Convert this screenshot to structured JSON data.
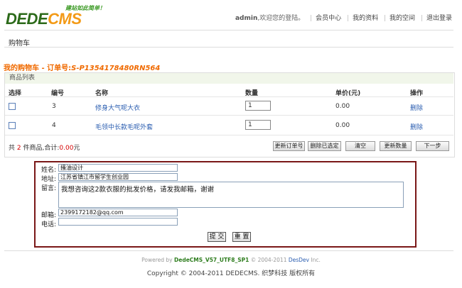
{
  "header": {
    "logo_main": "DEDE",
    "logo_accent": "CMS",
    "slogan": "建站如此简单！",
    "user": "admin",
    "welcome": ",欢迎您的登陆。",
    "nav": [
      "会员中心",
      "我的资料",
      "我的空间",
      "退出登录"
    ]
  },
  "breadcrumb": "购物车",
  "order": {
    "title_prefix": "我的购物车 - 订单号:",
    "order_no": "S-P1354178480RN564"
  },
  "list": {
    "caption": "商品列表",
    "columns": [
      "选择",
      "编号",
      "名称",
      "数量",
      "单价(元)",
      "操作"
    ],
    "rows": [
      {
        "id": "3",
        "name": "修身大气呢大衣",
        "qty": "1",
        "price": "0.00",
        "action": "删除"
      },
      {
        "id": "4",
        "name": "毛领中长款毛呢外套",
        "qty": "1",
        "price": "0.00",
        "action": "删除"
      }
    ],
    "summary_prefix": "共",
    "summary_count": "2",
    "summary_mid": "件商品,合计:",
    "summary_total": "0.00",
    "summary_unit": "元",
    "buttons": [
      "更新订单号",
      "删除已选定",
      "清空",
      "更新数量",
      "下一步"
    ]
  },
  "form": {
    "name_label": "姓名:",
    "name_value": "搔油设计",
    "address_label": "地址:",
    "address_value": "江苏省镇江市留学生创业园",
    "message_label": "留言:",
    "message_value": "我想咨询这2款衣服的批发价格，请发我邮箱，谢谢",
    "email_label": "邮箱:",
    "email_value": "2399172182@qq.com",
    "phone_label": "电话:",
    "phone_value": "",
    "submit_label": "提 交",
    "reset_label": "重 置"
  },
  "footer": {
    "powered_prefix": "Powered by ",
    "powered_product": "DedeCMS_V57_UTF8_SP1",
    "powered_mid": " © 2004-2011 ",
    "powered_company": "DesDev",
    "powered_suffix": " Inc.",
    "copyright": "Copyright © 2004-2011 DEDECMS. 织梦科技 版权所有"
  }
}
